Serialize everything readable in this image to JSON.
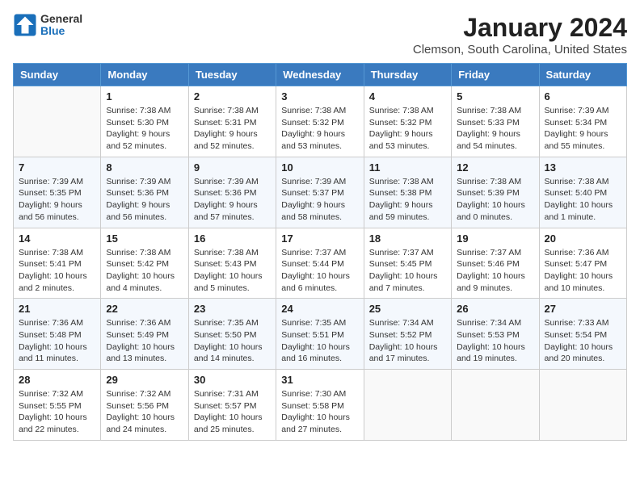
{
  "logo": {
    "general": "General",
    "blue": "Blue"
  },
  "title": "January 2024",
  "subtitle": "Clemson, South Carolina, United States",
  "weekdays": [
    "Sunday",
    "Monday",
    "Tuesday",
    "Wednesday",
    "Thursday",
    "Friday",
    "Saturday"
  ],
  "weeks": [
    [
      {
        "day": "",
        "info": ""
      },
      {
        "day": "1",
        "info": "Sunrise: 7:38 AM\nSunset: 5:30 PM\nDaylight: 9 hours\nand 52 minutes."
      },
      {
        "day": "2",
        "info": "Sunrise: 7:38 AM\nSunset: 5:31 PM\nDaylight: 9 hours\nand 52 minutes."
      },
      {
        "day": "3",
        "info": "Sunrise: 7:38 AM\nSunset: 5:32 PM\nDaylight: 9 hours\nand 53 minutes."
      },
      {
        "day": "4",
        "info": "Sunrise: 7:38 AM\nSunset: 5:32 PM\nDaylight: 9 hours\nand 53 minutes."
      },
      {
        "day": "5",
        "info": "Sunrise: 7:38 AM\nSunset: 5:33 PM\nDaylight: 9 hours\nand 54 minutes."
      },
      {
        "day": "6",
        "info": "Sunrise: 7:39 AM\nSunset: 5:34 PM\nDaylight: 9 hours\nand 55 minutes."
      }
    ],
    [
      {
        "day": "7",
        "info": "Sunrise: 7:39 AM\nSunset: 5:35 PM\nDaylight: 9 hours\nand 56 minutes."
      },
      {
        "day": "8",
        "info": "Sunrise: 7:39 AM\nSunset: 5:36 PM\nDaylight: 9 hours\nand 56 minutes."
      },
      {
        "day": "9",
        "info": "Sunrise: 7:39 AM\nSunset: 5:36 PM\nDaylight: 9 hours\nand 57 minutes."
      },
      {
        "day": "10",
        "info": "Sunrise: 7:39 AM\nSunset: 5:37 PM\nDaylight: 9 hours\nand 58 minutes."
      },
      {
        "day": "11",
        "info": "Sunrise: 7:38 AM\nSunset: 5:38 PM\nDaylight: 9 hours\nand 59 minutes."
      },
      {
        "day": "12",
        "info": "Sunrise: 7:38 AM\nSunset: 5:39 PM\nDaylight: 10 hours\nand 0 minutes."
      },
      {
        "day": "13",
        "info": "Sunrise: 7:38 AM\nSunset: 5:40 PM\nDaylight: 10 hours\nand 1 minute."
      }
    ],
    [
      {
        "day": "14",
        "info": "Sunrise: 7:38 AM\nSunset: 5:41 PM\nDaylight: 10 hours\nand 2 minutes."
      },
      {
        "day": "15",
        "info": "Sunrise: 7:38 AM\nSunset: 5:42 PM\nDaylight: 10 hours\nand 4 minutes."
      },
      {
        "day": "16",
        "info": "Sunrise: 7:38 AM\nSunset: 5:43 PM\nDaylight: 10 hours\nand 5 minutes."
      },
      {
        "day": "17",
        "info": "Sunrise: 7:37 AM\nSunset: 5:44 PM\nDaylight: 10 hours\nand 6 minutes."
      },
      {
        "day": "18",
        "info": "Sunrise: 7:37 AM\nSunset: 5:45 PM\nDaylight: 10 hours\nand 7 minutes."
      },
      {
        "day": "19",
        "info": "Sunrise: 7:37 AM\nSunset: 5:46 PM\nDaylight: 10 hours\nand 9 minutes."
      },
      {
        "day": "20",
        "info": "Sunrise: 7:36 AM\nSunset: 5:47 PM\nDaylight: 10 hours\nand 10 minutes."
      }
    ],
    [
      {
        "day": "21",
        "info": "Sunrise: 7:36 AM\nSunset: 5:48 PM\nDaylight: 10 hours\nand 11 minutes."
      },
      {
        "day": "22",
        "info": "Sunrise: 7:36 AM\nSunset: 5:49 PM\nDaylight: 10 hours\nand 13 minutes."
      },
      {
        "day": "23",
        "info": "Sunrise: 7:35 AM\nSunset: 5:50 PM\nDaylight: 10 hours\nand 14 minutes."
      },
      {
        "day": "24",
        "info": "Sunrise: 7:35 AM\nSunset: 5:51 PM\nDaylight: 10 hours\nand 16 minutes."
      },
      {
        "day": "25",
        "info": "Sunrise: 7:34 AM\nSunset: 5:52 PM\nDaylight: 10 hours\nand 17 minutes."
      },
      {
        "day": "26",
        "info": "Sunrise: 7:34 AM\nSunset: 5:53 PM\nDaylight: 10 hours\nand 19 minutes."
      },
      {
        "day": "27",
        "info": "Sunrise: 7:33 AM\nSunset: 5:54 PM\nDaylight: 10 hours\nand 20 minutes."
      }
    ],
    [
      {
        "day": "28",
        "info": "Sunrise: 7:32 AM\nSunset: 5:55 PM\nDaylight: 10 hours\nand 22 minutes."
      },
      {
        "day": "29",
        "info": "Sunrise: 7:32 AM\nSunset: 5:56 PM\nDaylight: 10 hours\nand 24 minutes."
      },
      {
        "day": "30",
        "info": "Sunrise: 7:31 AM\nSunset: 5:57 PM\nDaylight: 10 hours\nand 25 minutes."
      },
      {
        "day": "31",
        "info": "Sunrise: 7:30 AM\nSunset: 5:58 PM\nDaylight: 10 hours\nand 27 minutes."
      },
      {
        "day": "",
        "info": ""
      },
      {
        "day": "",
        "info": ""
      },
      {
        "day": "",
        "info": ""
      }
    ]
  ]
}
